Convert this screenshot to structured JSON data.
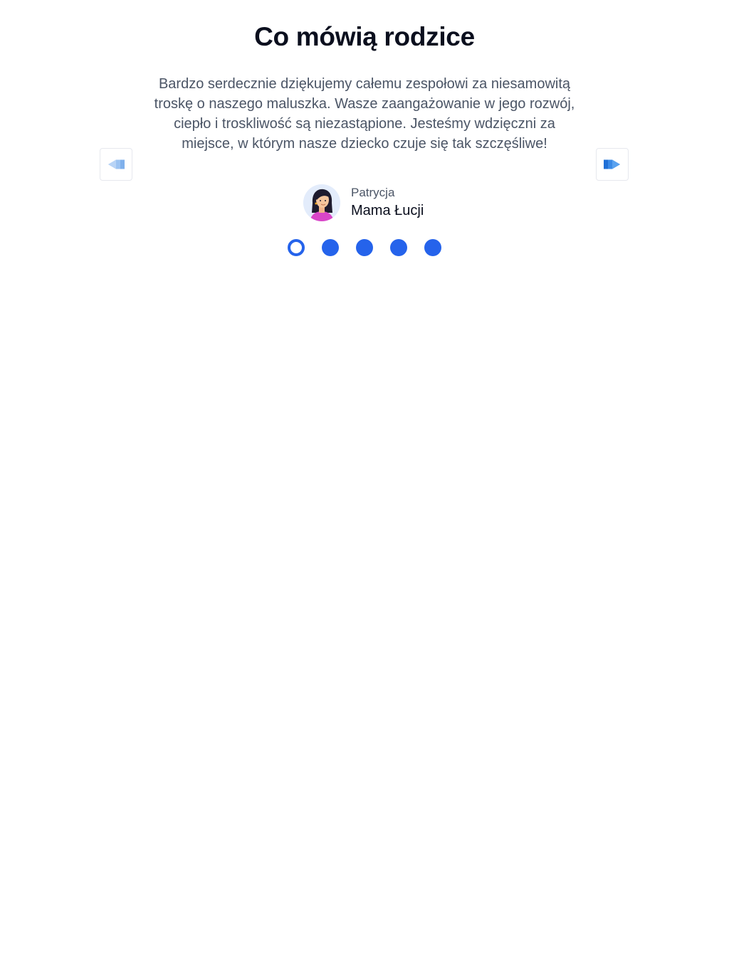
{
  "section": {
    "title": "Co mówią rodzice"
  },
  "testimonial": {
    "quote": "Bardzo serdecznie dziękujemy całemu zespołowi za niesamowitą troskę o naszego maluszka. Wasze zaangażowanie w jego rozwój, ciepło i troskliwość są niezastąpione. Jesteśmy wdzięczni za miejsce, w którym nasze dziecko czuje się tak szczęśliwe!",
    "author_name": "Patrycja",
    "author_role": "Mama Łucji"
  },
  "navigation": {
    "prev_icon": "arrow-left-icon",
    "next_icon": "arrow-right-icon"
  },
  "pagination": {
    "total": 5,
    "active_index": 0
  },
  "colors": {
    "accent": "#2563eb",
    "title": "#0b0f1e",
    "body_text": "#4b5566"
  }
}
